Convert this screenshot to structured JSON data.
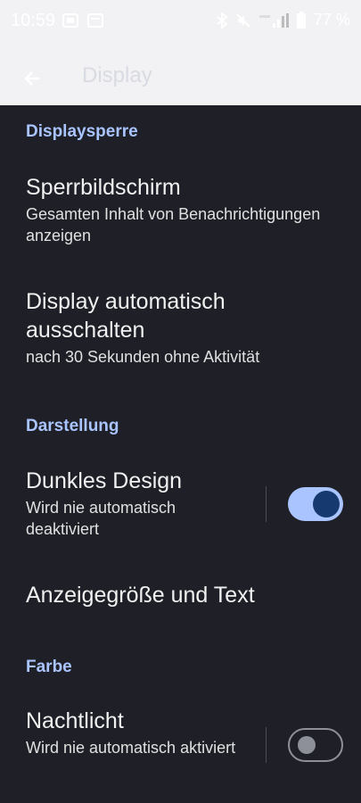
{
  "status": {
    "time": "10:59",
    "battery": "77 %",
    "icons": [
      "sim-icon",
      "calendar-icon",
      "bluetooth-icon",
      "mute-icon",
      "signal-icon",
      "battery-icon"
    ]
  },
  "appbar": {
    "title": "Display",
    "back_icon": "back-arrow-icon"
  },
  "sections": {
    "lock": "Displaysperre",
    "appearance": "Darstellung",
    "color": "Farbe"
  },
  "items": {
    "lockscreen": {
      "title": "Sperrbildschirm",
      "subtitle": "Gesamten Inhalt von Benachrichtigungen anzeigen"
    },
    "timeout": {
      "title": "Display automatisch ausschalten",
      "subtitle": "nach 30 Sekunden ohne Aktivität"
    },
    "dark": {
      "title": "Dunkles Design",
      "subtitle": "Wird nie automatisch deaktiviert",
      "enabled": true
    },
    "size": {
      "title": "Anzeigegröße und Text"
    },
    "night": {
      "title": "Nachtlicht",
      "subtitle": "Wird nie automatisch aktiviert",
      "enabled": false
    }
  },
  "colors": {
    "accent": "#a9c4ff",
    "background": "#1f2027",
    "header": "#f2f2f4"
  }
}
